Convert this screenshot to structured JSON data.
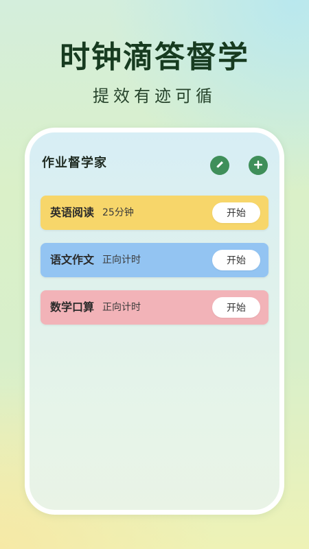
{
  "hero": {
    "title": "时钟滴答督学",
    "subtitle": "提效有迹可循"
  },
  "app": {
    "title": "作业督学家",
    "edit_icon": "pencil-icon",
    "add_icon": "plus-icon",
    "accent_color": "#3f8f5a"
  },
  "tasks": [
    {
      "name": "英语阅读",
      "mode": "25分钟",
      "start_label": "开始",
      "color": "#f7d66a"
    },
    {
      "name": "语文作文",
      "mode": "正向计时",
      "start_label": "开始",
      "color": "#93c4f2"
    },
    {
      "name": "数学口算",
      "mode": "正向计时",
      "start_label": "开始",
      "color": "#f2b3b8"
    }
  ]
}
